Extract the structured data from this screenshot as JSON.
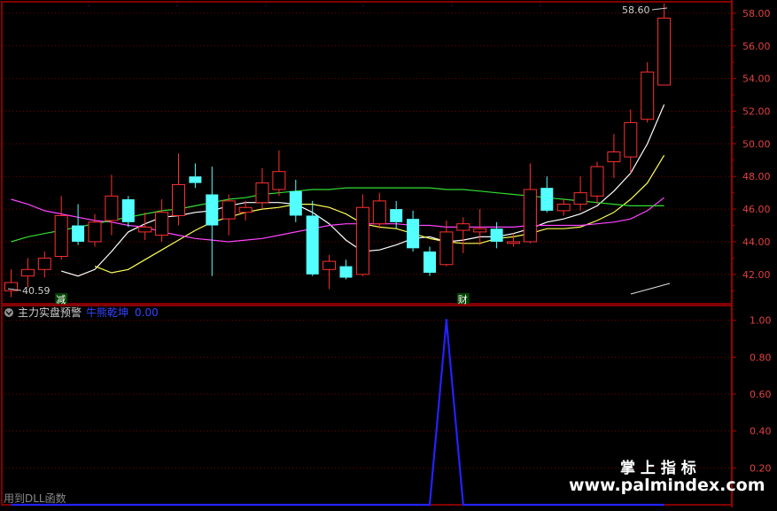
{
  "colors": {
    "background": "#000000",
    "frame": "#b00000",
    "grid": "#7a0000",
    "axis_text": "#e04040",
    "candle_up": "#ff3030",
    "candle_down": "#54ffff",
    "ma5": "#ffffff",
    "ma10": "#ffff55",
    "ma20": "#ff44ff",
    "ma60": "#33dd33",
    "signal": "#2222ff",
    "panel_title": "#d0d0d0",
    "indicator_value": "#3344ff"
  },
  "main_panel": {
    "y_ticks": [
      "58.00",
      "56.00",
      "54.00",
      "52.00",
      "50.00",
      "48.00",
      "46.00",
      "44.00",
      "42.00"
    ],
    "high_label": "58.60",
    "low_label": "40.59",
    "badges": [
      {
        "text": "减",
        "bar_index": 3
      },
      {
        "text": "财",
        "bar_index": 27
      }
    ]
  },
  "sub_panel": {
    "title": "主力实盘预警",
    "indicator_name": "牛熊乾坤",
    "indicator_value": "0.00",
    "y_ticks": [
      "1.00",
      "0.80",
      "0.60",
      "0.40",
      "0.20"
    ],
    "footer_text": "用到DLL函数"
  },
  "watermark": {
    "cn": "掌 上 指 标",
    "url": "www.palmindex.com"
  },
  "chart_data": [
    {
      "type": "candlestick",
      "ylim": [
        40.2,
        58.7
      ],
      "grid": true,
      "bars": [
        {
          "o": 41.0,
          "c": 41.5,
          "h": 42.3,
          "l": 40.6
        },
        {
          "o": 41.9,
          "c": 42.3,
          "h": 43.0,
          "l": 41.2
        },
        {
          "o": 42.3,
          "c": 43.0,
          "h": 43.4,
          "l": 41.8
        },
        {
          "o": 43.1,
          "c": 45.6,
          "h": 46.8,
          "l": 42.9
        },
        {
          "o": 45.0,
          "c": 44.0,
          "h": 46.3,
          "l": 43.8
        },
        {
          "o": 44.0,
          "c": 45.2,
          "h": 45.7,
          "l": 43.7
        },
        {
          "o": 45.3,
          "c": 46.8,
          "h": 48.1,
          "l": 44.4
        },
        {
          "o": 46.6,
          "c": 45.2,
          "h": 46.8,
          "l": 44.9
        },
        {
          "o": 44.6,
          "c": 44.9,
          "h": 45.8,
          "l": 44.1
        },
        {
          "o": 44.4,
          "c": 45.8,
          "h": 46.6,
          "l": 44.0
        },
        {
          "o": 45.6,
          "c": 47.5,
          "h": 49.4,
          "l": 45.0
        },
        {
          "o": 48.0,
          "c": 47.6,
          "h": 48.8,
          "l": 47.3
        },
        {
          "o": 46.9,
          "c": 45.0,
          "h": 48.6,
          "l": 41.9
        },
        {
          "o": 45.4,
          "c": 46.5,
          "h": 46.9,
          "l": 44.4
        },
        {
          "o": 45.8,
          "c": 46.1,
          "h": 46.5,
          "l": 45.3
        },
        {
          "o": 46.4,
          "c": 47.6,
          "h": 48.5,
          "l": 46.0
        },
        {
          "o": 47.2,
          "c": 48.3,
          "h": 49.6,
          "l": 46.8
        },
        {
          "o": 47.1,
          "c": 45.6,
          "h": 47.8,
          "l": 45.2
        },
        {
          "o": 45.6,
          "c": 42.0,
          "h": 46.5,
          "l": 41.9
        },
        {
          "o": 42.3,
          "c": 42.8,
          "h": 43.2,
          "l": 41.1
        },
        {
          "o": 42.5,
          "c": 41.8,
          "h": 42.9,
          "l": 41.7
        },
        {
          "o": 42.0,
          "c": 46.1,
          "h": 46.9,
          "l": 41.9
        },
        {
          "o": 45.1,
          "c": 46.5,
          "h": 47.0,
          "l": 44.8
        },
        {
          "o": 46.0,
          "c": 45.2,
          "h": 46.5,
          "l": 44.8
        },
        {
          "o": 45.4,
          "c": 43.6,
          "h": 45.9,
          "l": 43.4
        },
        {
          "o": 43.4,
          "c": 42.1,
          "h": 43.7,
          "l": 41.9
        },
        {
          "o": 42.6,
          "c": 44.6,
          "h": 45.3,
          "l": 42.5
        },
        {
          "o": 44.7,
          "c": 45.1,
          "h": 45.5,
          "l": 43.3
        },
        {
          "o": 44.6,
          "c": 44.8,
          "h": 46.0,
          "l": 43.8
        },
        {
          "o": 44.8,
          "c": 44.0,
          "h": 45.2,
          "l": 43.6
        },
        {
          "o": 43.9,
          "c": 44.0,
          "h": 44.5,
          "l": 43.7
        },
        {
          "o": 44.0,
          "c": 47.2,
          "h": 48.8,
          "l": 43.9
        },
        {
          "o": 47.3,
          "c": 45.9,
          "h": 48.0,
          "l": 45.8
        },
        {
          "o": 45.9,
          "c": 46.3,
          "h": 46.6,
          "l": 45.6
        },
        {
          "o": 46.3,
          "c": 47.0,
          "h": 48.0,
          "l": 45.9
        },
        {
          "o": 46.8,
          "c": 48.6,
          "h": 48.9,
          "l": 46.3
        },
        {
          "o": 48.9,
          "c": 49.5,
          "h": 50.6,
          "l": 47.9
        },
        {
          "o": 49.2,
          "c": 51.3,
          "h": 52.1,
          "l": 48.2
        },
        {
          "o": 51.5,
          "c": 54.4,
          "h": 55.0,
          "l": 51.3
        },
        {
          "o": 53.6,
          "c": 57.7,
          "h": 58.6,
          "l": 53.6
        }
      ],
      "ma_series": [
        {
          "key": "ma5",
          "values": [
            43.9,
            null,
            null,
            42.2,
            41.9,
            42.3,
            43.4,
            44.6,
            45.1,
            45.5,
            45.6,
            45.8,
            45.9,
            46.2,
            46.4,
            46.4,
            46.4,
            46.3,
            45.8,
            45.1,
            44.1,
            43.4,
            43.5,
            43.8,
            44.2,
            44.3,
            44.0,
            44.1,
            44.3,
            44.3,
            44.5,
            44.8,
            45.2,
            45.4,
            45.7,
            46.2,
            47.1,
            48.2,
            50.0,
            52.4
          ]
        },
        {
          "ma10": true,
          "key": "ma10",
          "values": [
            null,
            null,
            null,
            null,
            null,
            42.5,
            42.1,
            42.3,
            42.9,
            43.5,
            44.1,
            44.7,
            45.2,
            45.5,
            45.8,
            46.0,
            46.1,
            46.3,
            46.3,
            46.1,
            45.7,
            45.1,
            44.9,
            44.8,
            44.5,
            44.2,
            44.0,
            43.9,
            43.9,
            44.2,
            44.3,
            44.5,
            44.8,
            44.8,
            44.9,
            45.3,
            45.8,
            46.6,
            47.6,
            49.3
          ]
        },
        {
          "key": "ma20",
          "values": [
            46.6,
            46.3,
            45.9,
            45.7,
            45.5,
            45.3,
            45.2,
            45.0,
            44.9,
            44.6,
            44.4,
            44.2,
            44.1,
            44.0,
            44.1,
            44.2,
            44.4,
            44.6,
            44.8,
            45.0,
            45.1,
            45.1,
            45.1,
            45.1,
            45.0,
            45.0,
            44.9,
            44.9,
            44.9,
            44.9,
            44.9,
            45.0,
            45.0,
            45.0,
            45.0,
            45.1,
            45.2,
            45.4,
            45.9,
            46.7
          ]
        },
        {
          "key": "ma60",
          "values": [
            44.0,
            44.3,
            44.5,
            44.7,
            44.9,
            45.1,
            45.3,
            45.5,
            45.7,
            45.9,
            46.0,
            46.2,
            46.4,
            46.6,
            46.7,
            46.9,
            47.0,
            47.1,
            47.2,
            47.2,
            47.3,
            47.3,
            47.3,
            47.3,
            47.3,
            47.3,
            47.2,
            47.2,
            47.1,
            47.0,
            46.9,
            46.8,
            46.7,
            46.6,
            46.5,
            46.4,
            46.3,
            46.2,
            46.2,
            46.2
          ]
        }
      ]
    },
    {
      "type": "line",
      "name": "牛熊乾坤",
      "ylim": [
        0,
        1.08
      ],
      "values": [
        0,
        0,
        0,
        0,
        0,
        0,
        0,
        0,
        0,
        0,
        0,
        0,
        0,
        0,
        0,
        0,
        0,
        0,
        0,
        0,
        0,
        0,
        0,
        0,
        0,
        0,
        1,
        0,
        0,
        0,
        0,
        0,
        0,
        0,
        0,
        0,
        0,
        0,
        0,
        0
      ]
    }
  ]
}
